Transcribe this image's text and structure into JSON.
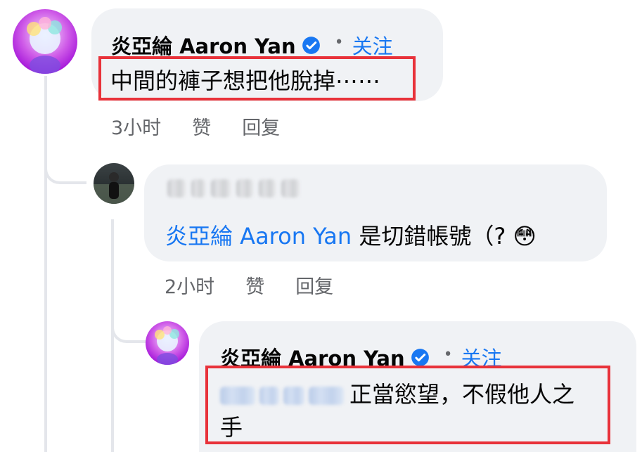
{
  "comments": [
    {
      "author": "炎亞綸 Aaron Yan",
      "verified": true,
      "follow_label": "关注",
      "text": "中間的褲子想把他脫掉⋯⋯",
      "time": "3小时",
      "like_label": "赞",
      "reply_label": "回复"
    },
    {
      "author_hidden": true,
      "mention": "炎亞綸 Aaron Yan",
      "text": " 是切錯帳號（?",
      "emoji": "😳",
      "time": "2小时",
      "like_label": "赞",
      "reply_label": "回复"
    },
    {
      "author": "炎亞綸 Aaron Yan",
      "verified": true,
      "follow_label": "关注",
      "mention_hidden": true,
      "text_line1": "正當慾望，不假他人之",
      "text_line2": "手"
    }
  ],
  "colors": {
    "link_blue": "#1877f2",
    "bubble_gray": "#f0f2f5",
    "meta_gray": "#65676b",
    "highlight_red": "#e8323a"
  }
}
